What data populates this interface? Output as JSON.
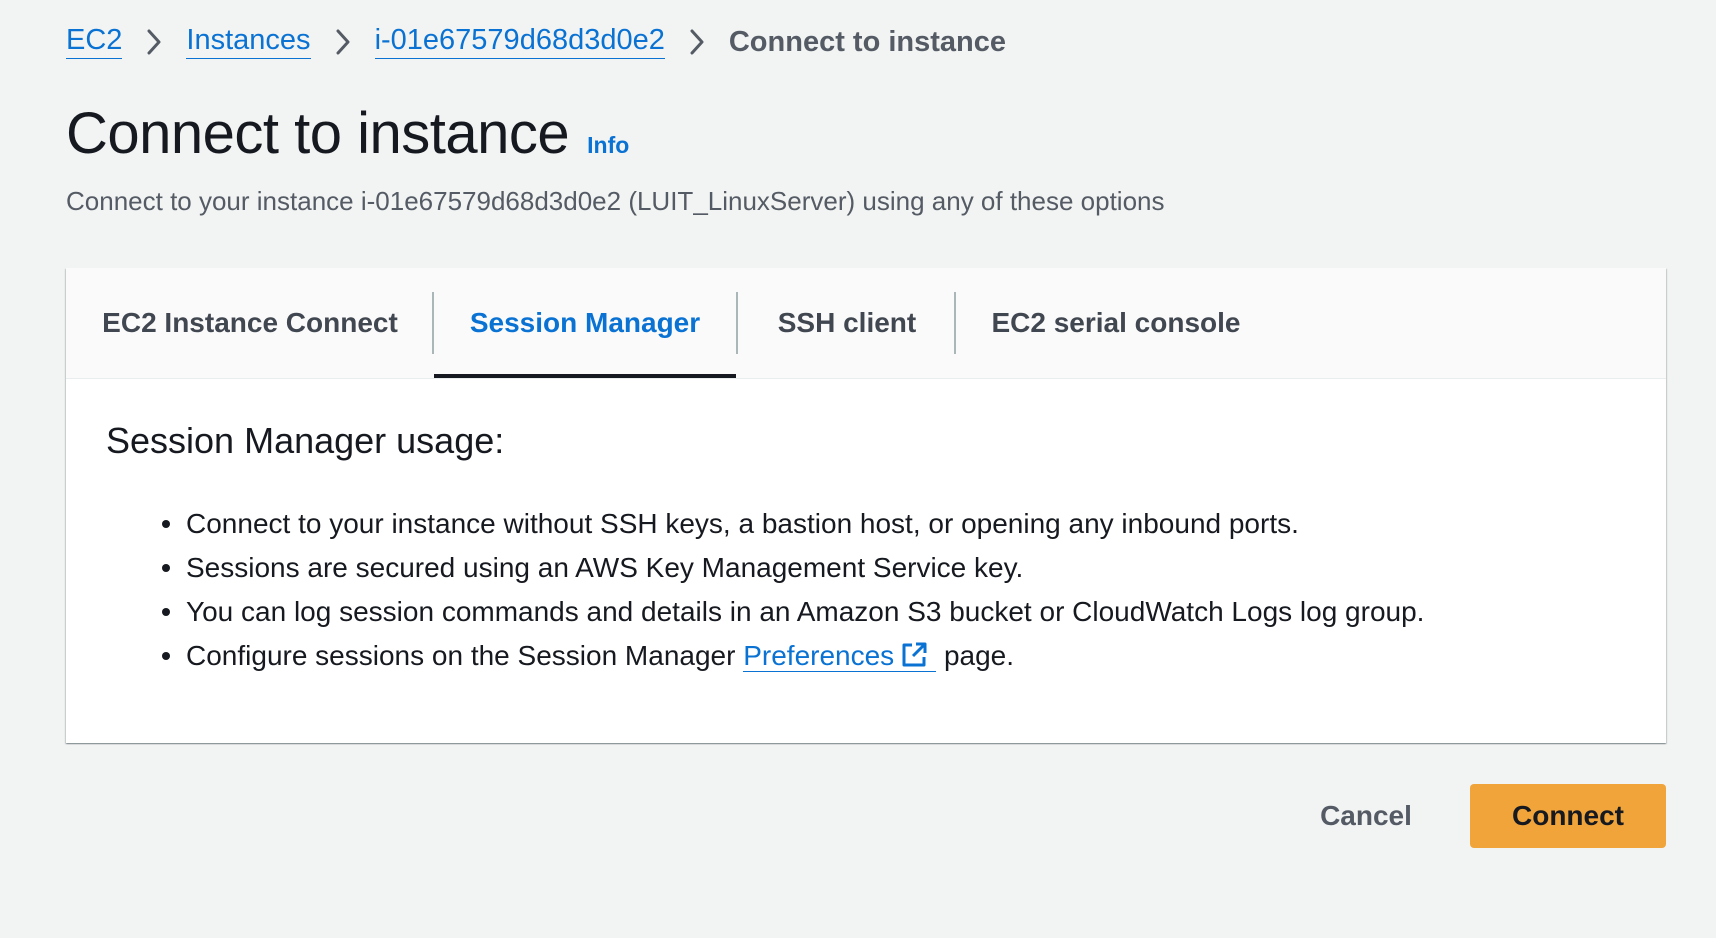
{
  "breadcrumb": {
    "items": [
      {
        "label": "EC2"
      },
      {
        "label": "Instances"
      },
      {
        "label": "i-01e67579d68d3d0e2"
      }
    ],
    "current": "Connect to instance"
  },
  "header": {
    "title": "Connect to instance",
    "info_label": "Info",
    "description": "Connect to your instance i-01e67579d68d3d0e2 (LUIT_LinuxServer) using any of these options"
  },
  "tabs": [
    {
      "label": "EC2 Instance Connect",
      "active": false
    },
    {
      "label": "Session Manager",
      "active": true
    },
    {
      "label": "SSH client",
      "active": false
    },
    {
      "label": "EC2 serial console",
      "active": false
    }
  ],
  "session_manager": {
    "title": "Session Manager usage:",
    "items": [
      "Connect to your instance without SSH keys, a bastion host, or opening any inbound ports.",
      "Sessions are secured using an AWS Key Management Service key.",
      "You can log session commands and details in an Amazon S3 bucket or CloudWatch Logs log group."
    ],
    "configure": {
      "prefix": "Configure sessions on the Session Manager ",
      "link": "Preferences",
      "suffix": " page.",
      "link_icon": "external-link-icon"
    }
  },
  "footer": {
    "cancel_label": "Cancel",
    "connect_label": "Connect"
  },
  "colors": {
    "page_bg": "#f2f3f3",
    "link": "#0972d3",
    "primary_button": "#f0a43a",
    "active_tab_indicator": "#16191f"
  }
}
